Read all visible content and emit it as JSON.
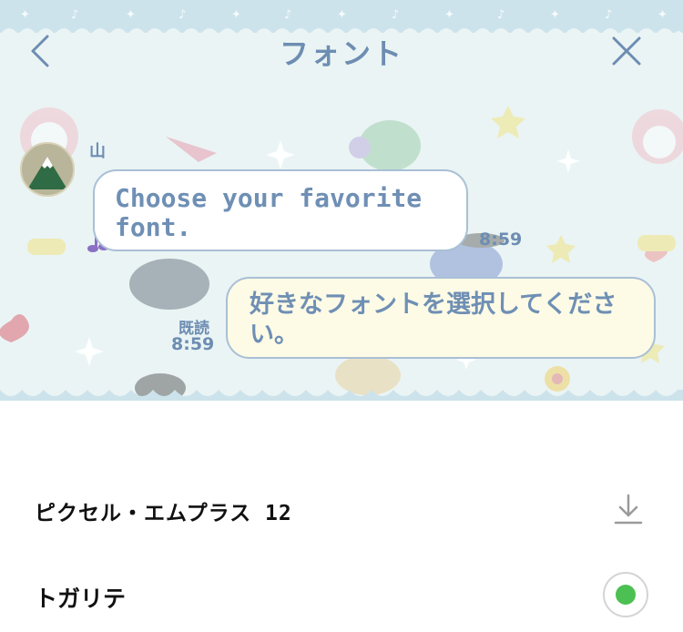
{
  "header": {
    "title": "フォント"
  },
  "chat": {
    "sender_name": "山",
    "incoming_message": "Choose your favorite font.",
    "incoming_time": "8:59",
    "outgoing_message": "好きなフォントを選択してください。",
    "read_label": "既読",
    "outgoing_time": "8:59"
  },
  "font_list": {
    "items": [
      {
        "label": "ピクセル・エムプラス 12",
        "status": "download",
        "icon": "download-icon"
      },
      {
        "label": "トガリテ",
        "status": "selected",
        "icon": "radio-selected-icon"
      }
    ]
  },
  "colors": {
    "accent_text": "#6d8db2",
    "preview_bg": "#eaf4f4",
    "bubble_outgoing": "#fdfbe6",
    "selected_green": "#4cc052"
  }
}
